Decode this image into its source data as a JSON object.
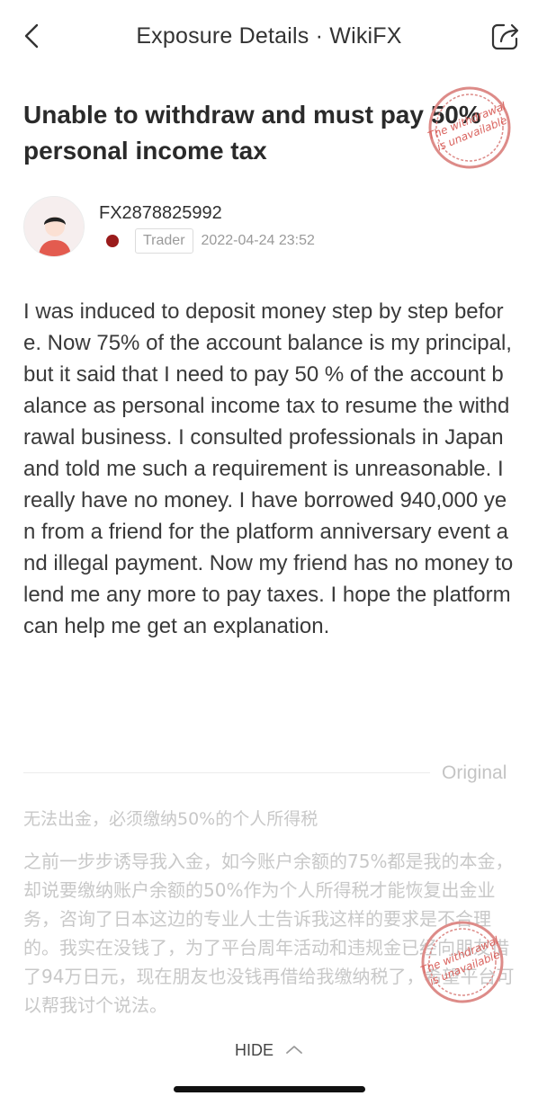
{
  "nav": {
    "title": "Exposure Details · WikiFX",
    "back_icon": "chevron-left-icon",
    "share_icon": "share-icon"
  },
  "post": {
    "title": "Unable to withdraw and must pay 50% personal income tax",
    "stamp_text_line1": "The withdrawal",
    "stamp_text_line2": "is unavailable",
    "stamp_color": "#d9534f",
    "author": {
      "id": "FX2878825992",
      "role": "Trader",
      "time": "2022-04-24 23:52",
      "flag_color": "#9a1b1b"
    },
    "body": "I was induced to deposit money step by step before. Now 75% of the account balance is my principal, but it said that I need to pay 50 % of the account balance as personal income tax to resume the withdrawal business. I consulted professionals in Japan and told me such a requirement is unreasonable. I really have no money. I have borrowed 940,000 yen from a friend for the platform anniversary event and illegal payment. Now my friend has no money to lend me any more to pay taxes. I hope the platform can help me get an explanation."
  },
  "original": {
    "label": "Original",
    "title": "无法出金，必须缴纳50%的个人所得税",
    "body": "之前一步步诱导我入金，如今账户余额的75%都是我的本金，却说要缴纳账户余额的50%作为个人所得税才能恢复出金业务，咨询了日本这边的专业人士告诉我这样的要求是不合理的。我实在没钱了，为了平台周年活动和违规金已经向朋友借了94万日元，现在朋友也没钱再借给我缴纳税了，希望平台可以帮我讨个说法。"
  },
  "footer": {
    "hide_label": "HIDE",
    "hide_icon": "chevron-up-icon"
  }
}
